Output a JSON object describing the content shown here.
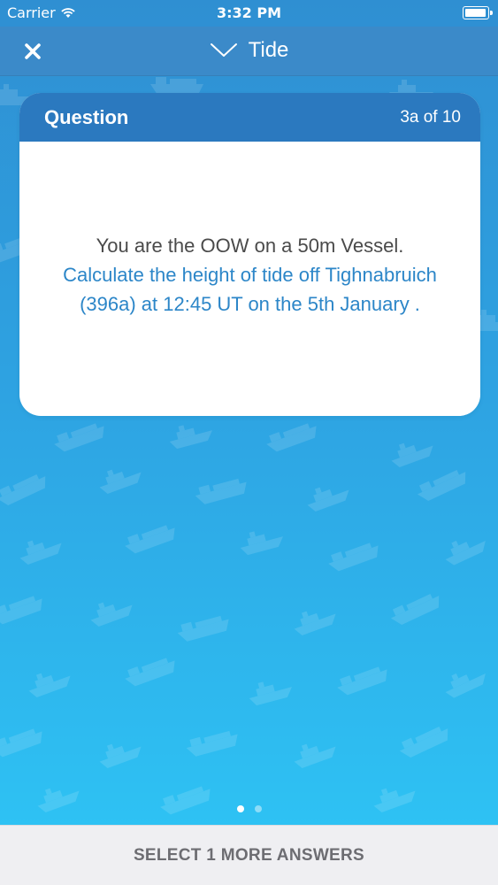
{
  "status_bar": {
    "carrier": "Carrier",
    "time": "3:32 PM",
    "icons": [
      "wifi-icon",
      "battery-icon"
    ]
  },
  "nav": {
    "close_icon": "close-icon",
    "title": "Tide",
    "title_icon": "chevron-down-icon",
    "background_color": "#3b8ac9"
  },
  "card": {
    "header_title": "Question",
    "progress": "3a of 10",
    "question_intro": "You are the OOW on a 50m Vessel.",
    "question_task": "Calculate the height of tide off Tighnabruich (396a) at 12:45  UT on the 5th January .",
    "header_color": "#2b79bf",
    "task_text_color": "#2c86c8"
  },
  "pagination": {
    "pages": 2,
    "active_page": 1
  },
  "footer": {
    "action_label": "SELECT 1 MORE ANSWERS"
  },
  "background": {
    "top_color": "#2f8fd2",
    "bottom_color": "#2ec6f6",
    "pattern": "ships-pattern"
  }
}
